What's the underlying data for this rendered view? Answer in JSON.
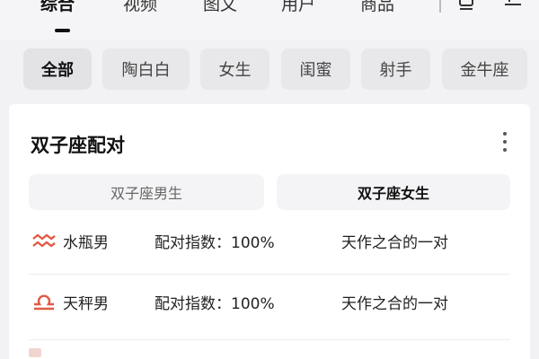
{
  "tabs": [
    {
      "label": "综合",
      "active": true
    },
    {
      "label": "视频",
      "active": false
    },
    {
      "label": "图文",
      "active": false
    },
    {
      "label": "用户",
      "active": false
    },
    {
      "label": "商品",
      "active": false
    }
  ],
  "toolbar_icons": [
    "layout-icon",
    "filter-icon"
  ],
  "chips": [
    {
      "label": "全部",
      "active": true
    },
    {
      "label": "陶白白",
      "active": false
    },
    {
      "label": "女生",
      "active": false
    },
    {
      "label": "闺蜜",
      "active": false
    },
    {
      "label": "射手",
      "active": false
    },
    {
      "label": "金牛座",
      "active": false
    }
  ],
  "card": {
    "title": "双子座配对",
    "segments": {
      "left": "双子座男生",
      "right": "双子座女生",
      "selected": "right"
    },
    "rows": [
      {
        "sign_icon": "aquarius-icon",
        "name": "水瓶男",
        "score": "配对指数：100%",
        "desc": "天作之合的一对"
      },
      {
        "sign_icon": "libra-icon",
        "name": "天秤男",
        "score": "配对指数：100%",
        "desc": "天作之合的一对"
      }
    ]
  },
  "colors": {
    "accent_sign": "#e05a45",
    "text": "#222222",
    "card_bg": "#ffffff",
    "page_bg": "#f2f2f4"
  }
}
